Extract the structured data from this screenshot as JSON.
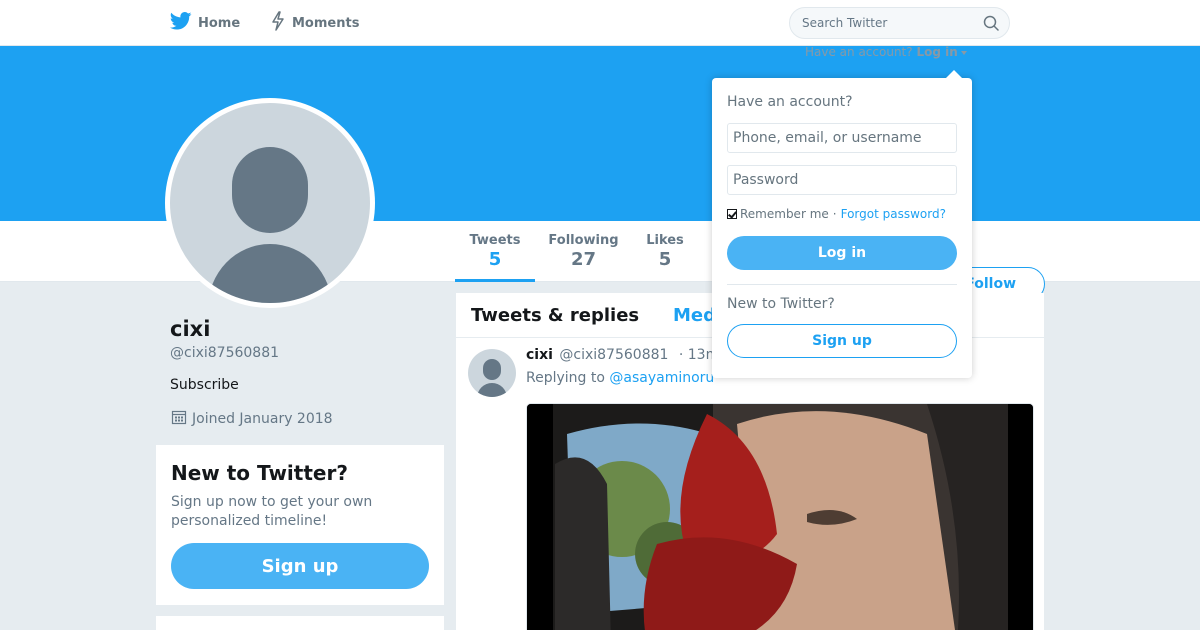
{
  "nav": {
    "home_label": "Home",
    "moments_label": "Moments"
  },
  "search": {
    "placeholder": "Search Twitter"
  },
  "account_prompt": {
    "text": "Have an account?",
    "login_label": "Log in"
  },
  "profile": {
    "name": "cixi",
    "handle": "@cixi87560881",
    "subscribe_label": "Subscribe",
    "joined": "Joined January 2018"
  },
  "stats": {
    "tweets_label": "Tweets",
    "tweets_value": "5",
    "following_label": "Following",
    "following_value": "27",
    "likes_label": "Likes",
    "likes_value": "5"
  },
  "follow_label": "Follow",
  "new_card": {
    "title": "New to Twitter?",
    "subtitle": "Sign up now to get your own personalized timeline!",
    "signup_label": "Sign up"
  },
  "timeline": {
    "tab_replies": "Tweets & replies",
    "tab_media": "Media",
    "tweet": {
      "name": "cixi",
      "handle": "@cixi87560881",
      "time": "· 13m",
      "replying_prefix": "Replying to",
      "replying_to": "@asayaminoru"
    }
  },
  "login_dropdown": {
    "title": "Have an account?",
    "username_placeholder": "Phone, email, or username",
    "password_placeholder": "Password",
    "remember_label": "Remember me",
    "separator": "·",
    "forgot_label": "Forgot password?",
    "login_label": "Log in",
    "new_label": "New to Twitter?",
    "signup_label": "Sign up"
  },
  "colors": {
    "brand_blue": "#1da1f2",
    "button_blue": "#4ab3f4",
    "background": "#e6ecf0"
  }
}
